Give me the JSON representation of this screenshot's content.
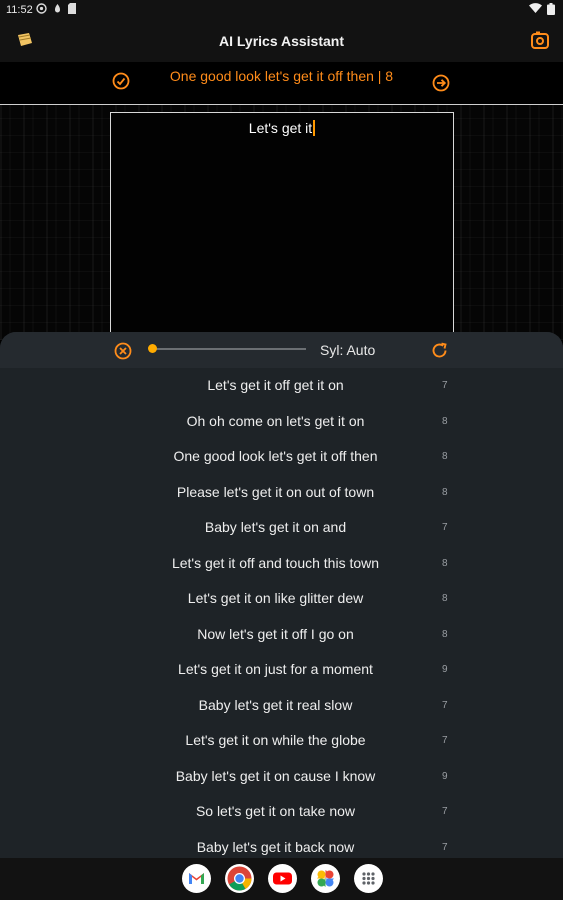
{
  "status_bar": {
    "time": "11:52",
    "icons": [
      "settings-status-icon",
      "notification-status-icon",
      "sd-card-status-icon"
    ],
    "right_icons": [
      "wifi-icon",
      "battery-icon"
    ]
  },
  "app_bar": {
    "title": "AI Lyrics Assistant",
    "left_icon": "notepad-icon",
    "right_icon": "camera-icon"
  },
  "header": {
    "current_line": "One good look let's get it off then  |  8",
    "left_icon": "check-circle-icon",
    "right_icon": "arrow-right-circle-icon"
  },
  "editor": {
    "text": "Let's get it"
  },
  "controls": {
    "syllable_label": "Syl: Auto",
    "slider_level": 0,
    "close_icon": "close-circle-icon",
    "refresh_icon": "refresh-icon"
  },
  "suggestions": [
    {
      "text": "Let's get it off get it on",
      "syllables": "7"
    },
    {
      "text": "Oh oh come on let's get it on",
      "syllables": "8"
    },
    {
      "text": "One good look let's get it off then",
      "syllables": "8"
    },
    {
      "text": "Please let's get it on out of town",
      "syllables": "8"
    },
    {
      "text": "Baby let's get it on and",
      "syllables": "7"
    },
    {
      "text": "Let's get it off and touch this town",
      "syllables": "8"
    },
    {
      "text": "Let's get it on like glitter dew",
      "syllables": "8"
    },
    {
      "text": "Now let's get it off I go on",
      "syllables": "8"
    },
    {
      "text": "Let's get it on just for a moment",
      "syllables": "9"
    },
    {
      "text": "Baby let's get it real slow",
      "syllables": "7"
    },
    {
      "text": "Let's get it on while the globe",
      "syllables": "7"
    },
    {
      "text": "Baby let's get it on cause I know",
      "syllables": "9"
    },
    {
      "text": "So let's get it on take now",
      "syllables": "7"
    },
    {
      "text": "Baby let's get it back now",
      "syllables": "7"
    }
  ],
  "dock": [
    "gmail-icon",
    "chrome-icon",
    "youtube-icon",
    "photos-icon",
    "app-drawer-icon"
  ],
  "colors": {
    "accent": "#ff8c1a",
    "slider": "#ffab00",
    "sheet": "#1e2327"
  }
}
